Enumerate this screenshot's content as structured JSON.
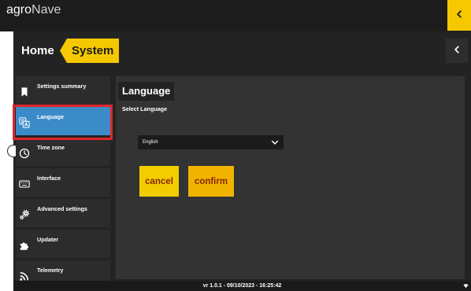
{
  "app": {
    "brand_primary": "agro",
    "brand_secondary": "Nave",
    "back_icon": "chevron-left-icon"
  },
  "breadcrumb": {
    "home": "Home",
    "current": "System",
    "back_icon": "chevron-left-icon"
  },
  "sidebar": {
    "items": [
      {
        "label": "Settings summary",
        "icon": "bookmark-icon",
        "active": false
      },
      {
        "label": "Language",
        "icon": "translate-icon",
        "active": true
      },
      {
        "label": "Time zone",
        "icon": "clock-icon",
        "active": false
      },
      {
        "label": "Interface",
        "icon": "keyboard-icon",
        "active": false
      },
      {
        "label": "Advanced settings",
        "icon": "gears-icon",
        "active": false
      },
      {
        "label": "Updater",
        "icon": "puzzle-icon",
        "active": false
      },
      {
        "label": "Telemetry",
        "icon": "rss-icon",
        "active": false
      }
    ]
  },
  "language_panel": {
    "title": "Language",
    "select_label": "Select Language",
    "selected_language": "English",
    "dropdown_icon": "chevron-down-icon",
    "cancel_label": "cancel",
    "confirm_label": "confirm"
  },
  "footer": {
    "version_info": "vr 1.0.1 - 09/10/2023 - 16:25:42",
    "status_icon": "signal-icon"
  },
  "colors": {
    "accent": "#f5c800",
    "active_item": "#3b8bc9",
    "item_bg": "#2c2c2c",
    "highlight_border": "#e0262a",
    "cancel_button": "#f2cd00",
    "confirm_button": "#f0b400",
    "button_text": "#8a2a00",
    "panel_bg": "#333333",
    "app_bg": "#232323"
  }
}
